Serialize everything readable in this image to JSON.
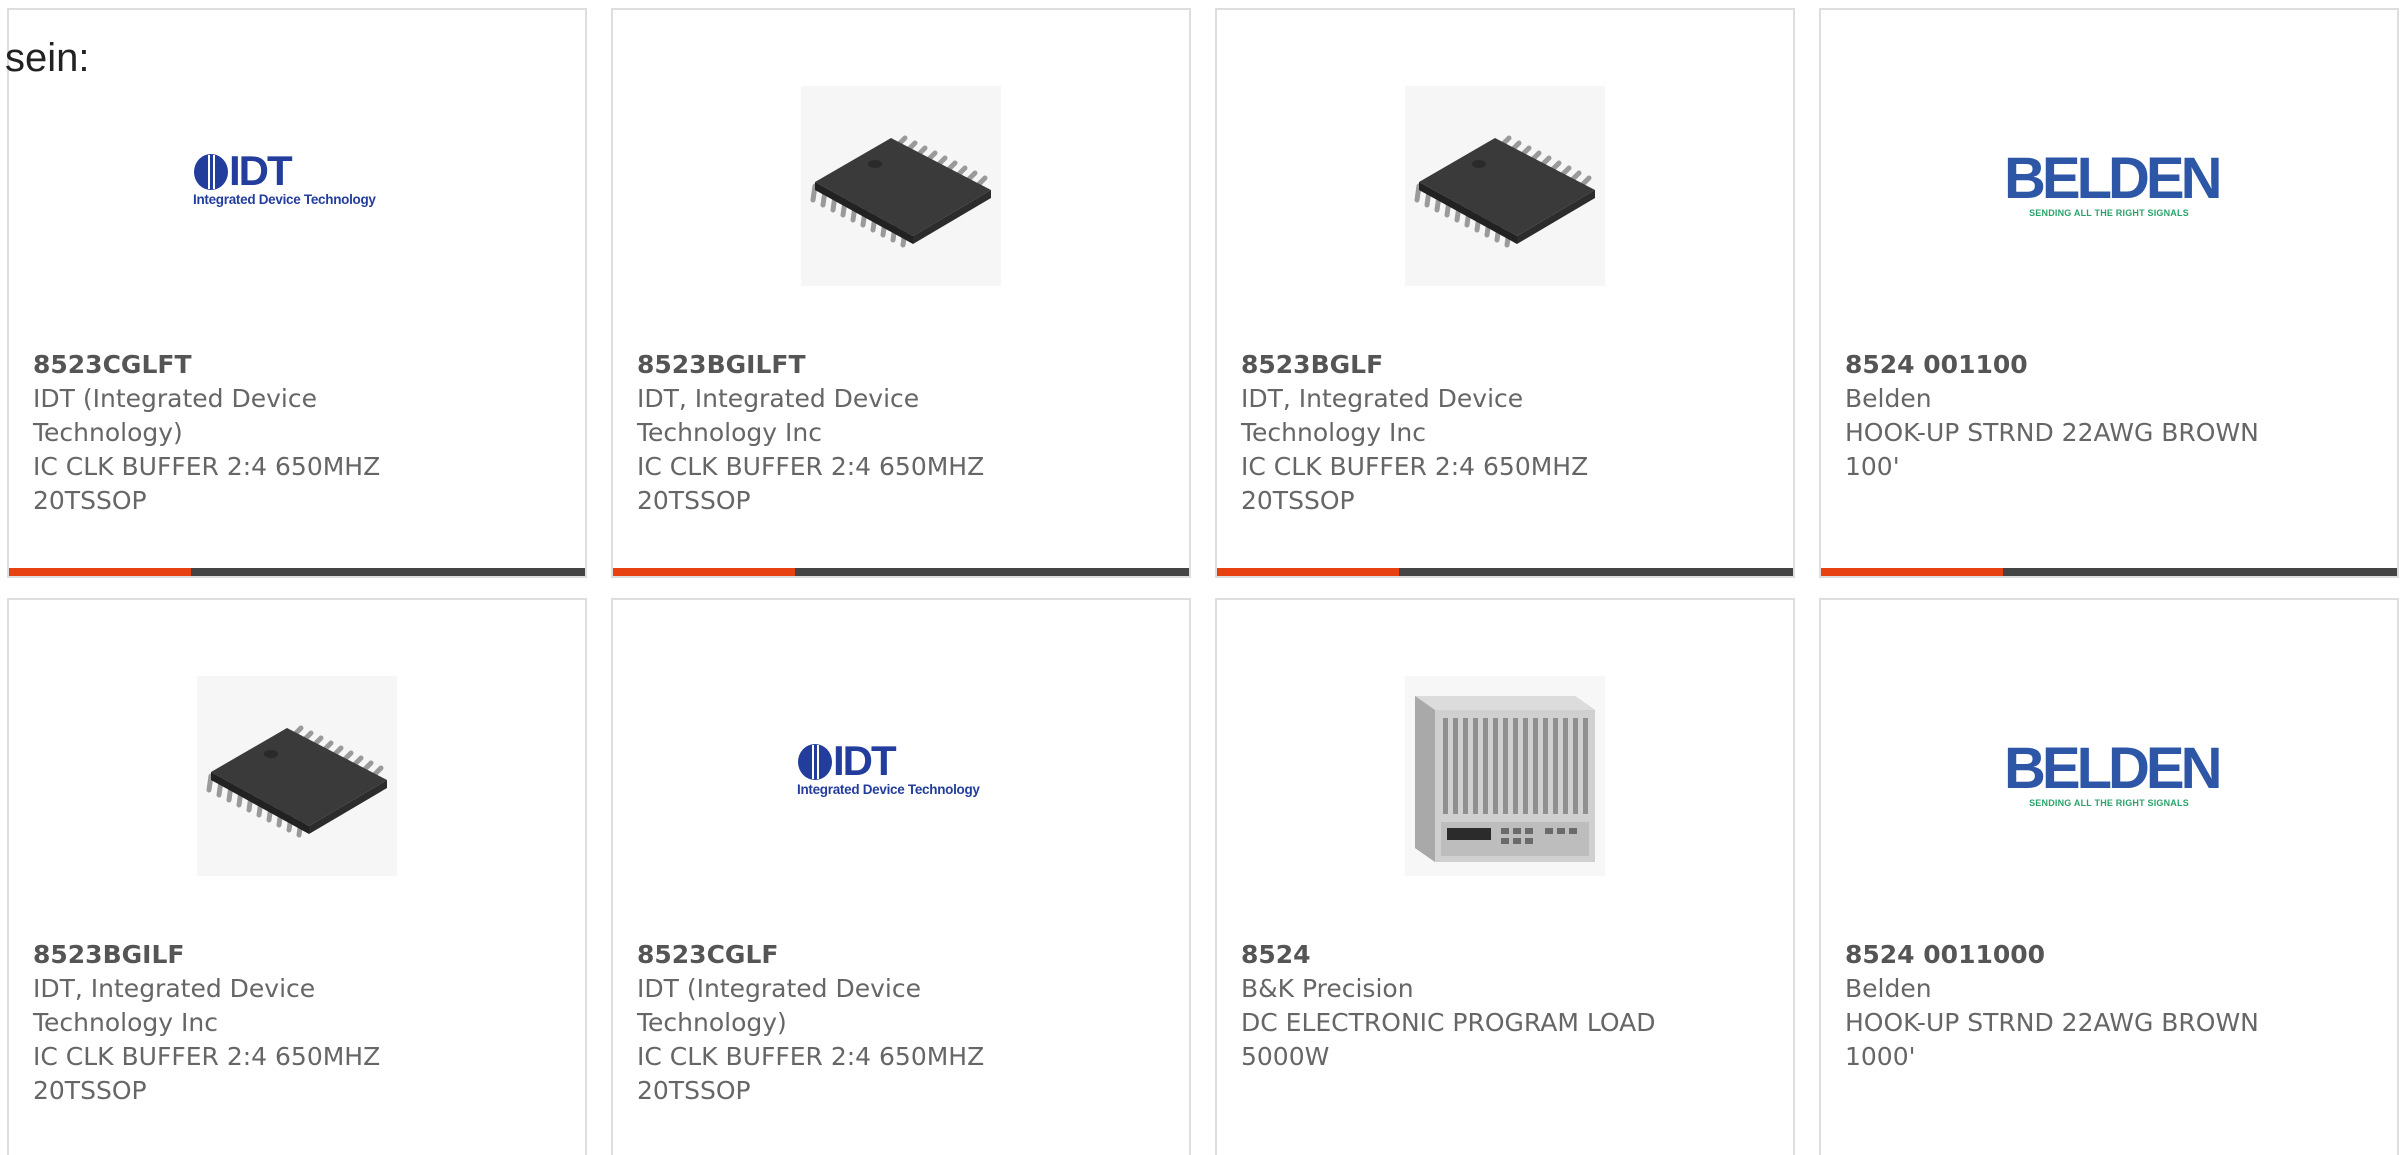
{
  "page": {
    "cutoff_text": "sein:"
  },
  "theme": {
    "accent_color": "#e84111",
    "bar_color": "#444444",
    "border_color": "#dedede",
    "part_color": "#555555",
    "text_color": "#666666",
    "idt_blue": "#233d9c",
    "belden_blue": "#2e56a6",
    "belden_green": "#2aa36b"
  },
  "logos": {
    "idt": {
      "word": "IDT",
      "tagline": "Integrated Device Technology"
    },
    "belden": {
      "word": "BELDEN",
      "tagline": "SENDING ALL THE RIGHT SIGNALS"
    }
  },
  "products": [
    {
      "image": "idt-logo",
      "part_number": "8523CGLFT",
      "manufacturer": "IDT (Integrated Device Technology)",
      "description": "IC CLK BUFFER 2:4 650MHZ 20TSSOP"
    },
    {
      "image": "tssop-chip",
      "part_number": "8523BGILFT",
      "manufacturer": "IDT, Integrated Device Technology Inc",
      "description": "IC CLK BUFFER 2:4 650MHZ 20TSSOP"
    },
    {
      "image": "tssop-chip",
      "part_number": "8523BGLF",
      "manufacturer": "IDT, Integrated Device Technology Inc",
      "description": "IC CLK BUFFER 2:4 650MHZ 20TSSOP"
    },
    {
      "image": "belden-logo",
      "part_number": "8524 001100",
      "manufacturer": "Belden",
      "description": "HOOK-UP STRND 22AWG BROWN 100'"
    },
    {
      "image": "tssop-chip",
      "part_number": "8523BGILF",
      "manufacturer": "IDT, Integrated Device Technology Inc",
      "description": "IC CLK BUFFER 2:4 650MHZ 20TSSOP"
    },
    {
      "image": "idt-logo",
      "part_number": "8523CGLF",
      "manufacturer": "IDT (Integrated Device Technology)",
      "description": "IC CLK BUFFER 2:4 650MHZ 20TSSOP"
    },
    {
      "image": "electronic-load",
      "part_number": "8524",
      "manufacturer": "B&K Precision",
      "description": "DC ELECTRONIC PROGRAM LOAD 5000W"
    },
    {
      "image": "belden-logo",
      "part_number": "8524 0011000",
      "manufacturer": "Belden",
      "description": "HOOK-UP STRND 22AWG BROWN 1000'"
    }
  ]
}
